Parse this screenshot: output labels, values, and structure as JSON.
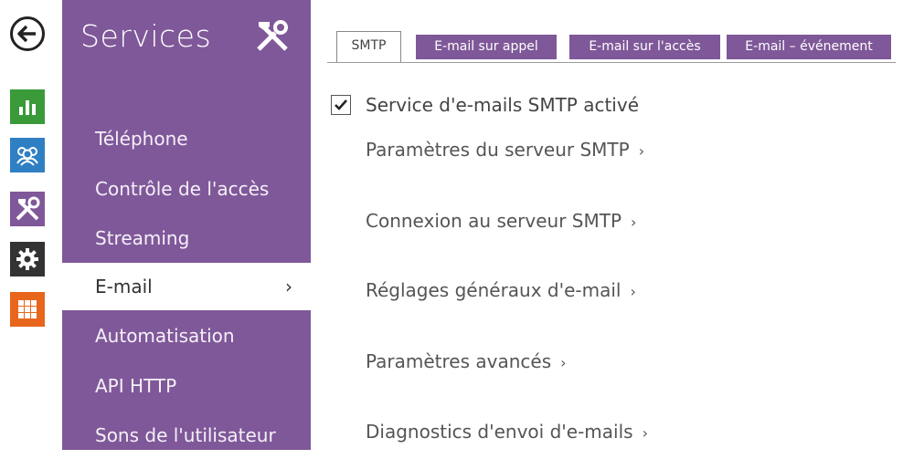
{
  "rail": {
    "icons": [
      "back-arrow-icon",
      "status-chart-icon",
      "directory-users-icon",
      "services-tools-icon",
      "hardware-gear-icon",
      "system-grid-icon"
    ],
    "colors": {
      "status": "#3a9a3a",
      "directory": "#2f7fc3",
      "services": "#7f5899",
      "hardware": "#333333",
      "system": "#e8661c"
    }
  },
  "menu": {
    "title": "Services",
    "title_icon": "tools-icon",
    "bg_color": "#7f5899",
    "items": [
      {
        "label": "Téléphone"
      },
      {
        "label": "Contrôle de l'accès"
      },
      {
        "label": "Streaming"
      },
      {
        "label": "E-mail",
        "chevron": "›"
      },
      {
        "label": "Automatisation"
      },
      {
        "label": "API HTTP"
      },
      {
        "label": "Sons de l'utilisateur"
      }
    ]
  },
  "tabs": [
    {
      "label": "SMTP"
    },
    {
      "label": "E-mail sur appel"
    },
    {
      "label": "E-mail sur l'accès"
    },
    {
      "label": "E-mail – événement"
    }
  ],
  "content": {
    "smtp_enabled_label": "Service d'e-mails SMTP activé",
    "smtp_enabled": true,
    "links": [
      {
        "label": "Paramètres du serveur SMTP",
        "chevron": "›"
      },
      {
        "label": "Connexion au serveur SMTP",
        "chevron": "›"
      },
      {
        "label": "Réglages généraux d'e-mail",
        "chevron": "›"
      },
      {
        "label": "Paramètres avancés",
        "chevron": "›"
      },
      {
        "label": "Diagnostics d'envoi d'e-mails",
        "chevron": "›"
      }
    ]
  }
}
